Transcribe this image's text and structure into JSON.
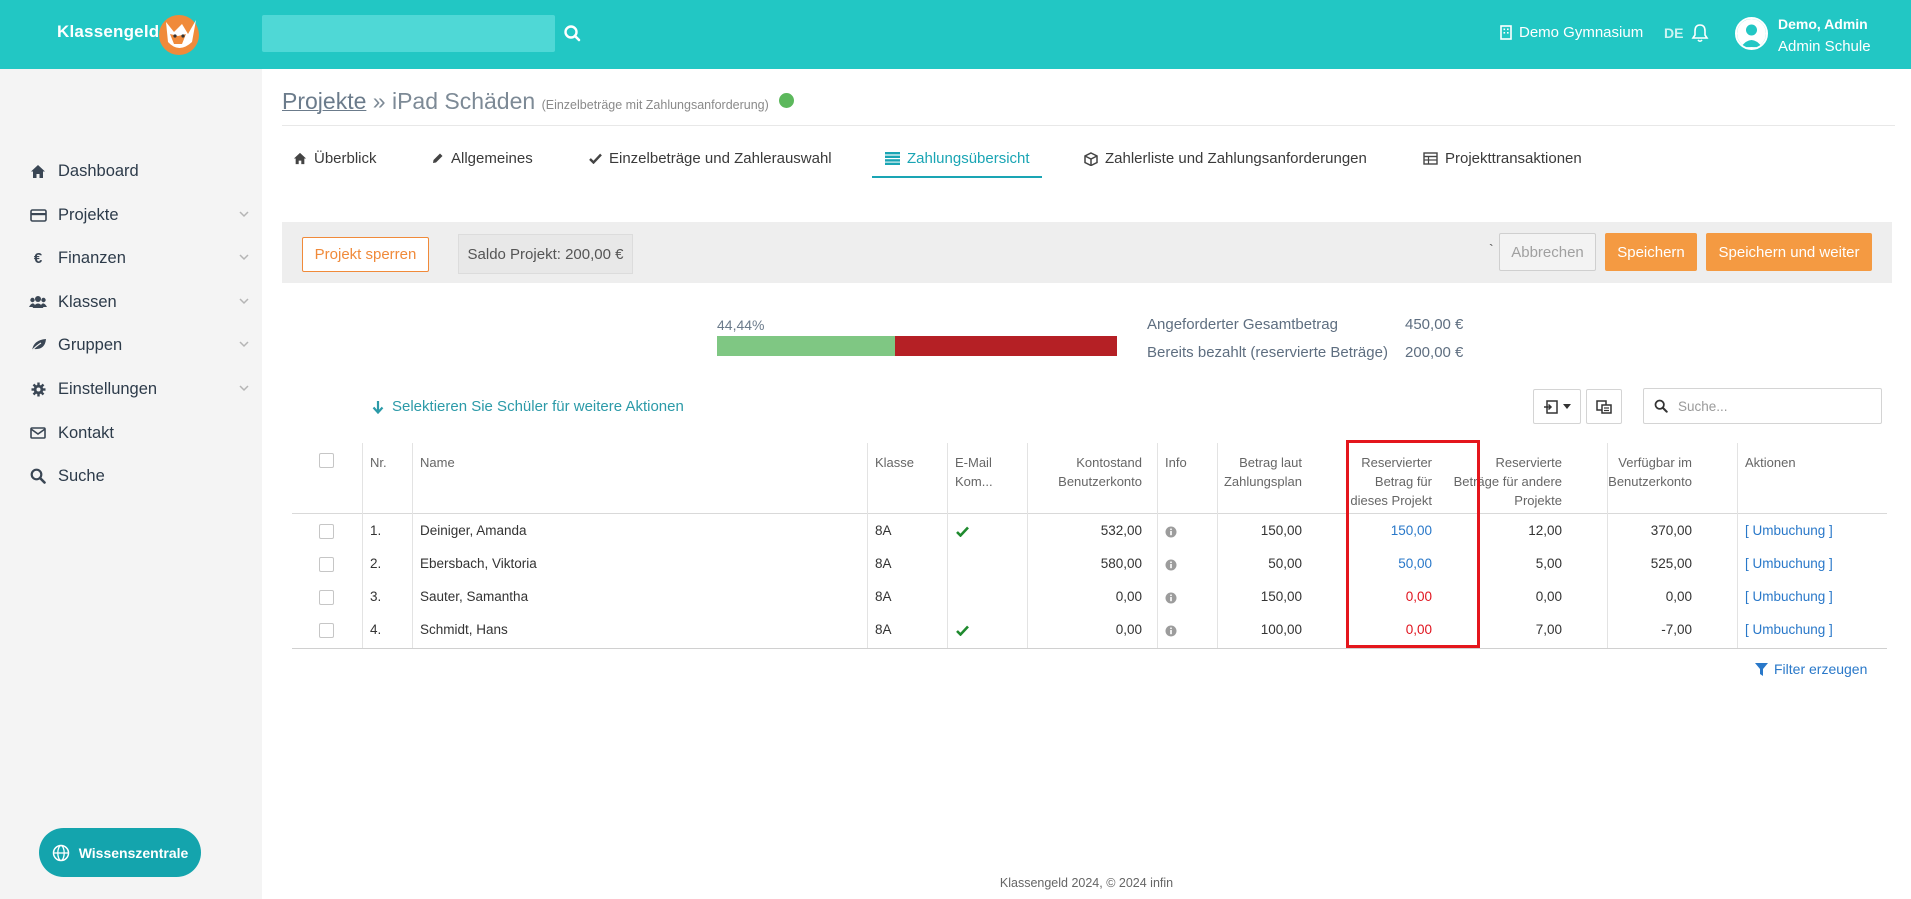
{
  "header": {
    "brand": "Klassengeld",
    "school": "Demo Gymnasium",
    "language": "DE",
    "user_name": "Demo, Admin",
    "user_role": "Admin Schule",
    "search_placeholder": ""
  },
  "sidebar": {
    "items": [
      {
        "label": "Dashboard",
        "icon": "home-icon"
      },
      {
        "label": "Projekte",
        "icon": "credit-card-icon"
      },
      {
        "label": "Finanzen",
        "icon": "euro-icon"
      },
      {
        "label": "Klassen",
        "icon": "users-icon"
      },
      {
        "label": "Gruppen",
        "icon": "leaf-icon"
      },
      {
        "label": "Einstellungen",
        "icon": "gear-icon"
      },
      {
        "label": "Kontakt",
        "icon": "envelope-icon"
      },
      {
        "label": "Suche",
        "icon": "search-icon"
      }
    ],
    "knowledge_button": "Wissenszentrale"
  },
  "breadcrumb": {
    "root": "Projekte",
    "separator": " » ",
    "project": "iPad Schäden",
    "subtitle": "(Einzelbeträge mit Zahlungsanforderung)",
    "status_color": "#5cb85c"
  },
  "tabs": [
    {
      "label": "Überblick",
      "icon": "home-icon"
    },
    {
      "label": "Allgemeines",
      "icon": "pencil-icon"
    },
    {
      "label": "Einzelbeträge und Zahlerauswahl",
      "icon": "check-icon"
    },
    {
      "label": "Zahlungsübersicht",
      "icon": "list-icon",
      "active": true
    },
    {
      "label": "Zahlerliste und Zahlungsanforderungen",
      "icon": "cube-icon"
    },
    {
      "label": "Projekttransaktionen",
      "icon": "table-icon"
    }
  ],
  "toolbar": {
    "lock_label": "Projekt sperren",
    "saldo_label": "Saldo Projekt: 200,00 €",
    "tick": "`",
    "cancel_label": "Abbrechen",
    "save_label": "Speichern",
    "save_next_label": "Speichern und weiter"
  },
  "progress": {
    "percent_label": "44,44%",
    "fraction": 0.4444,
    "paid_color": "#7fc783",
    "open_color": "#b52025",
    "requested_label": "Angeforderter Gesamtbetrag",
    "requested_value": "450,00 €",
    "paid_label": "Bereits bezahlt (reservierte Beträge)",
    "paid_value": "200,00 €"
  },
  "actions": {
    "select_hint": "Selektieren Sie Schüler für weitere Aktionen",
    "search_placeholder": "Suche..."
  },
  "table": {
    "columns": {
      "nr": "Nr.",
      "name": "Name",
      "klasse": "Klasse",
      "email": "E-Mail Kom...",
      "kontostand": "Kontostand Benutzerkonto",
      "info": "Info",
      "betrag": "Betrag laut Zahlungsplan",
      "reserviert": "Reservierter Betrag für dieses Projekt",
      "andere": "Reservierte Beträge für andere Projekte",
      "verfuegbar": "Verfügbar im Benutzerkonto",
      "aktionen": "Aktionen"
    },
    "rows": [
      {
        "nr": "1.",
        "name": "Deiniger, Amanda",
        "klasse": "8A",
        "email": true,
        "kontostand": "532,00",
        "betrag": "150,00",
        "reserviert": "150,00",
        "reserviert_status": "paid",
        "andere": "12,00",
        "verfuegbar": "370,00",
        "aktion": "[ Umbuchung ]"
      },
      {
        "nr": "2.",
        "name": "Ebersbach, Viktoria",
        "klasse": "8A",
        "email": false,
        "kontostand": "580,00",
        "betrag": "50,00",
        "reserviert": "50,00",
        "reserviert_status": "paid",
        "andere": "5,00",
        "verfuegbar": "525,00",
        "aktion": "[ Umbuchung ]"
      },
      {
        "nr": "3.",
        "name": "Sauter, Samantha",
        "klasse": "8A",
        "email": false,
        "kontostand": "0,00",
        "betrag": "150,00",
        "reserviert": "0,00",
        "reserviert_status": "open",
        "andere": "0,00",
        "verfuegbar": "0,00",
        "aktion": "[ Umbuchung ]"
      },
      {
        "nr": "4.",
        "name": "Schmidt, Hans",
        "klasse": "8A",
        "email": true,
        "kontostand": "0,00",
        "betrag": "100,00",
        "reserviert": "0,00",
        "reserviert_status": "open",
        "andere": "7,00",
        "verfuegbar": "-7,00",
        "aktion": "[ Umbuchung ]"
      }
    ],
    "filter_label": "Filter erzeugen"
  },
  "footer": "Klassengeld 2024, © 2024 infin",
  "colors": {
    "header": "#22c7c4",
    "accent": "#f49a42",
    "link": "#2978c9",
    "highlight": "#e4161c"
  }
}
